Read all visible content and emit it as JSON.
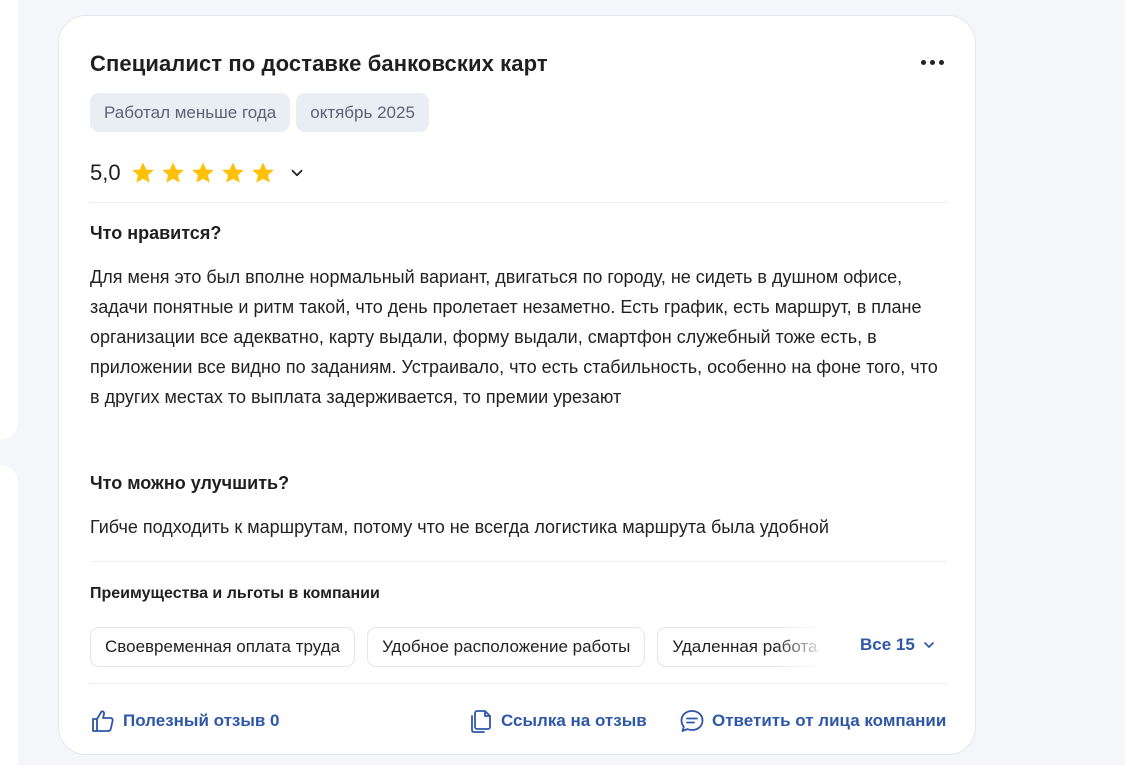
{
  "review": {
    "title": "Специалист по доставке банковских карт",
    "tags": [
      "Работал меньше года",
      "октябрь 2025"
    ],
    "rating": "5,0",
    "stars": 5,
    "star_color": "#ffc107",
    "likes_heading": "Что нравится?",
    "likes_text": "Для меня это был вполне нормальный вариант, двигаться по городу, не сидеть в душном офисе, задачи понятные и ритм такой, что день пролетает незаметно. Есть график, есть маршрут, в плане организации все адекватно, карту выдали, форму выдали, смартфон служебный тоже есть, в приложении все видно по заданиям. Устраивало, что есть стабильность, особенно на фоне того, что в других местах то выплата задерживается, то премии урезают",
    "improve_heading": "Что можно улучшить?",
    "improve_text": "Гибче подходить к маршрутам, потому что не всегда логистика маршрута была удобной",
    "benefits_title": "Преимущества и льготы в компании",
    "benefits": [
      "Своевременная оплата труда",
      "Удобное расположение работы",
      "Удаленная работа"
    ],
    "benefits_all": "Все 15"
  },
  "actions": {
    "helpful": "Полезный отзыв 0",
    "link": "Ссылка на отзыв",
    "reply": "Ответить от лица компании"
  },
  "colors": {
    "link": "#2f57a8",
    "tag_bg": "#e9edf4"
  }
}
